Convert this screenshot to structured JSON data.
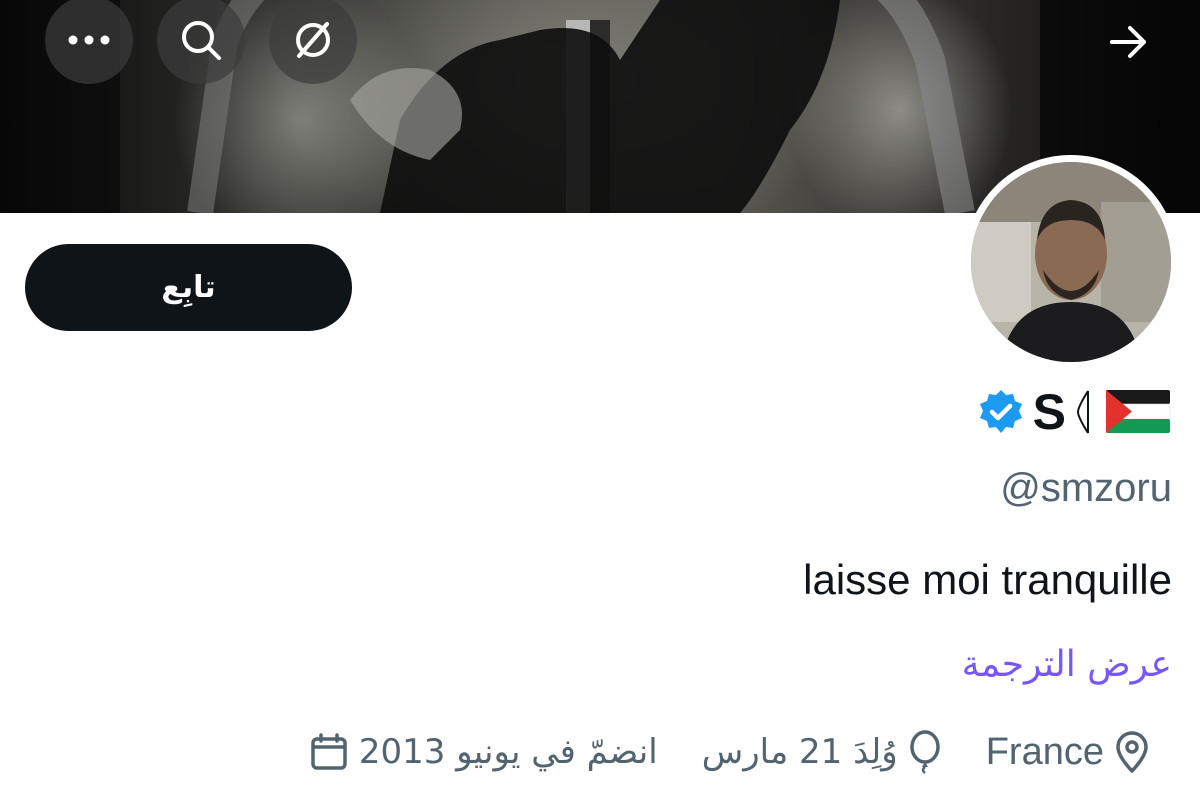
{
  "header": {
    "icons": [
      "more-icon",
      "search-icon",
      "no-signal-icon",
      "arrow-right-icon"
    ]
  },
  "profile": {
    "display_name": "S",
    "handle": "@smzoru",
    "bio": "laisse moi tranquille",
    "translate_link": "عرض الترجمة",
    "follow_label": "تابِع",
    "verified": true,
    "location": "France",
    "birthday": "وُلِدَ 21 مارس",
    "joined": "انضمّ في يونيو 2013"
  },
  "colors": {
    "accent": "#7856ff",
    "verified_badge": "#1d9bf0",
    "follow_button": "#0f1419",
    "secondary_text": "#536471"
  }
}
